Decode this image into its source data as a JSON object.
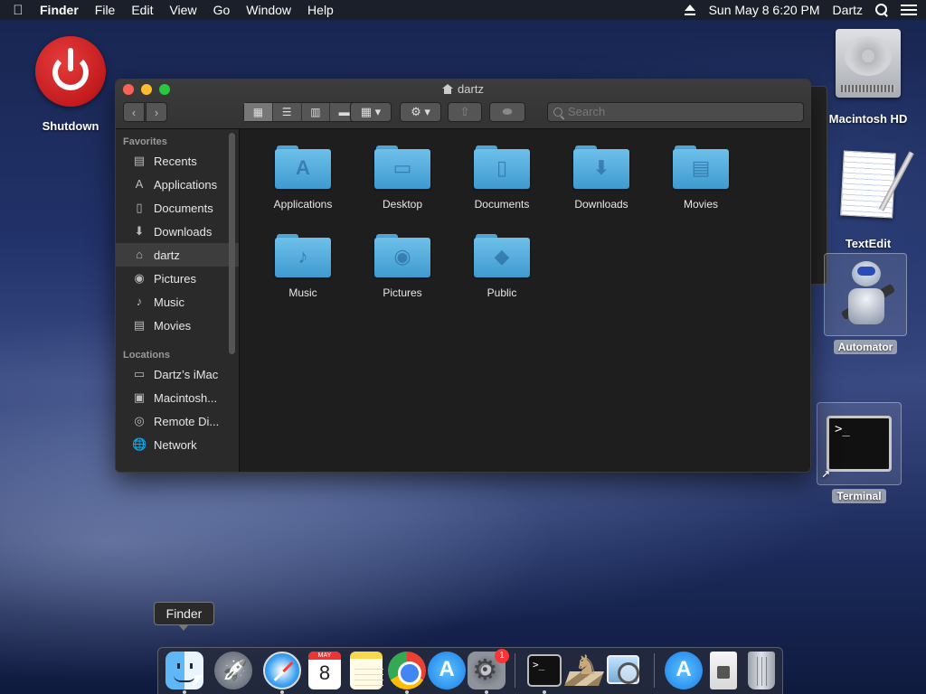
{
  "menubar": {
    "app_name": "Finder",
    "menus": [
      "File",
      "Edit",
      "View",
      "Go",
      "Window",
      "Help"
    ],
    "datetime": "Sun May 8  6:20 PM",
    "user": "Dartz"
  },
  "desktop": {
    "shutdown_label": "Shutdown",
    "hd_label": "Macintosh HD",
    "textedit_label": "TextEdit",
    "automator_label": "Automator",
    "terminal_label": "Terminal",
    "terminal_prompt": ">_"
  },
  "finder": {
    "title": "dartz",
    "search_placeholder": "Search",
    "sidebar": {
      "favorites_header": "Favorites",
      "favorites": [
        {
          "label": "Recents",
          "icon": "recents-icon"
        },
        {
          "label": "Applications",
          "icon": "applications-icon"
        },
        {
          "label": "Documents",
          "icon": "documents-icon"
        },
        {
          "label": "Downloads",
          "icon": "downloads-icon"
        },
        {
          "label": "dartz",
          "icon": "home-icon"
        },
        {
          "label": "Pictures",
          "icon": "camera-icon"
        },
        {
          "label": "Music",
          "icon": "music-note-icon"
        },
        {
          "label": "Movies",
          "icon": "film-icon"
        }
      ],
      "locations_header": "Locations",
      "locations": [
        {
          "label": "Dartz’s iMac",
          "icon": "imac-icon"
        },
        {
          "label": "Macintosh...",
          "icon": "disk-icon"
        },
        {
          "label": "Remote Di...",
          "icon": "remote-disc-icon"
        },
        {
          "label": "Network",
          "icon": "network-icon"
        }
      ],
      "selected": "dartz"
    },
    "items": [
      {
        "label": "Applications",
        "glyph": "A"
      },
      {
        "label": "Desktop",
        "glyph": "▭"
      },
      {
        "label": "Documents",
        "glyph": "▯"
      },
      {
        "label": "Downloads",
        "glyph": "⬇"
      },
      {
        "label": "Movies",
        "glyph": "▤"
      },
      {
        "label": "Music",
        "glyph": "♪"
      },
      {
        "label": "Pictures",
        "glyph": "◉"
      },
      {
        "label": "Public",
        "glyph": "◆"
      }
    ]
  },
  "dock": {
    "tooltip": "Finder",
    "calendar_month": "MAY",
    "calendar_day": "8",
    "sysprefs_badge": "1",
    "terminal_prompt": ">_"
  }
}
